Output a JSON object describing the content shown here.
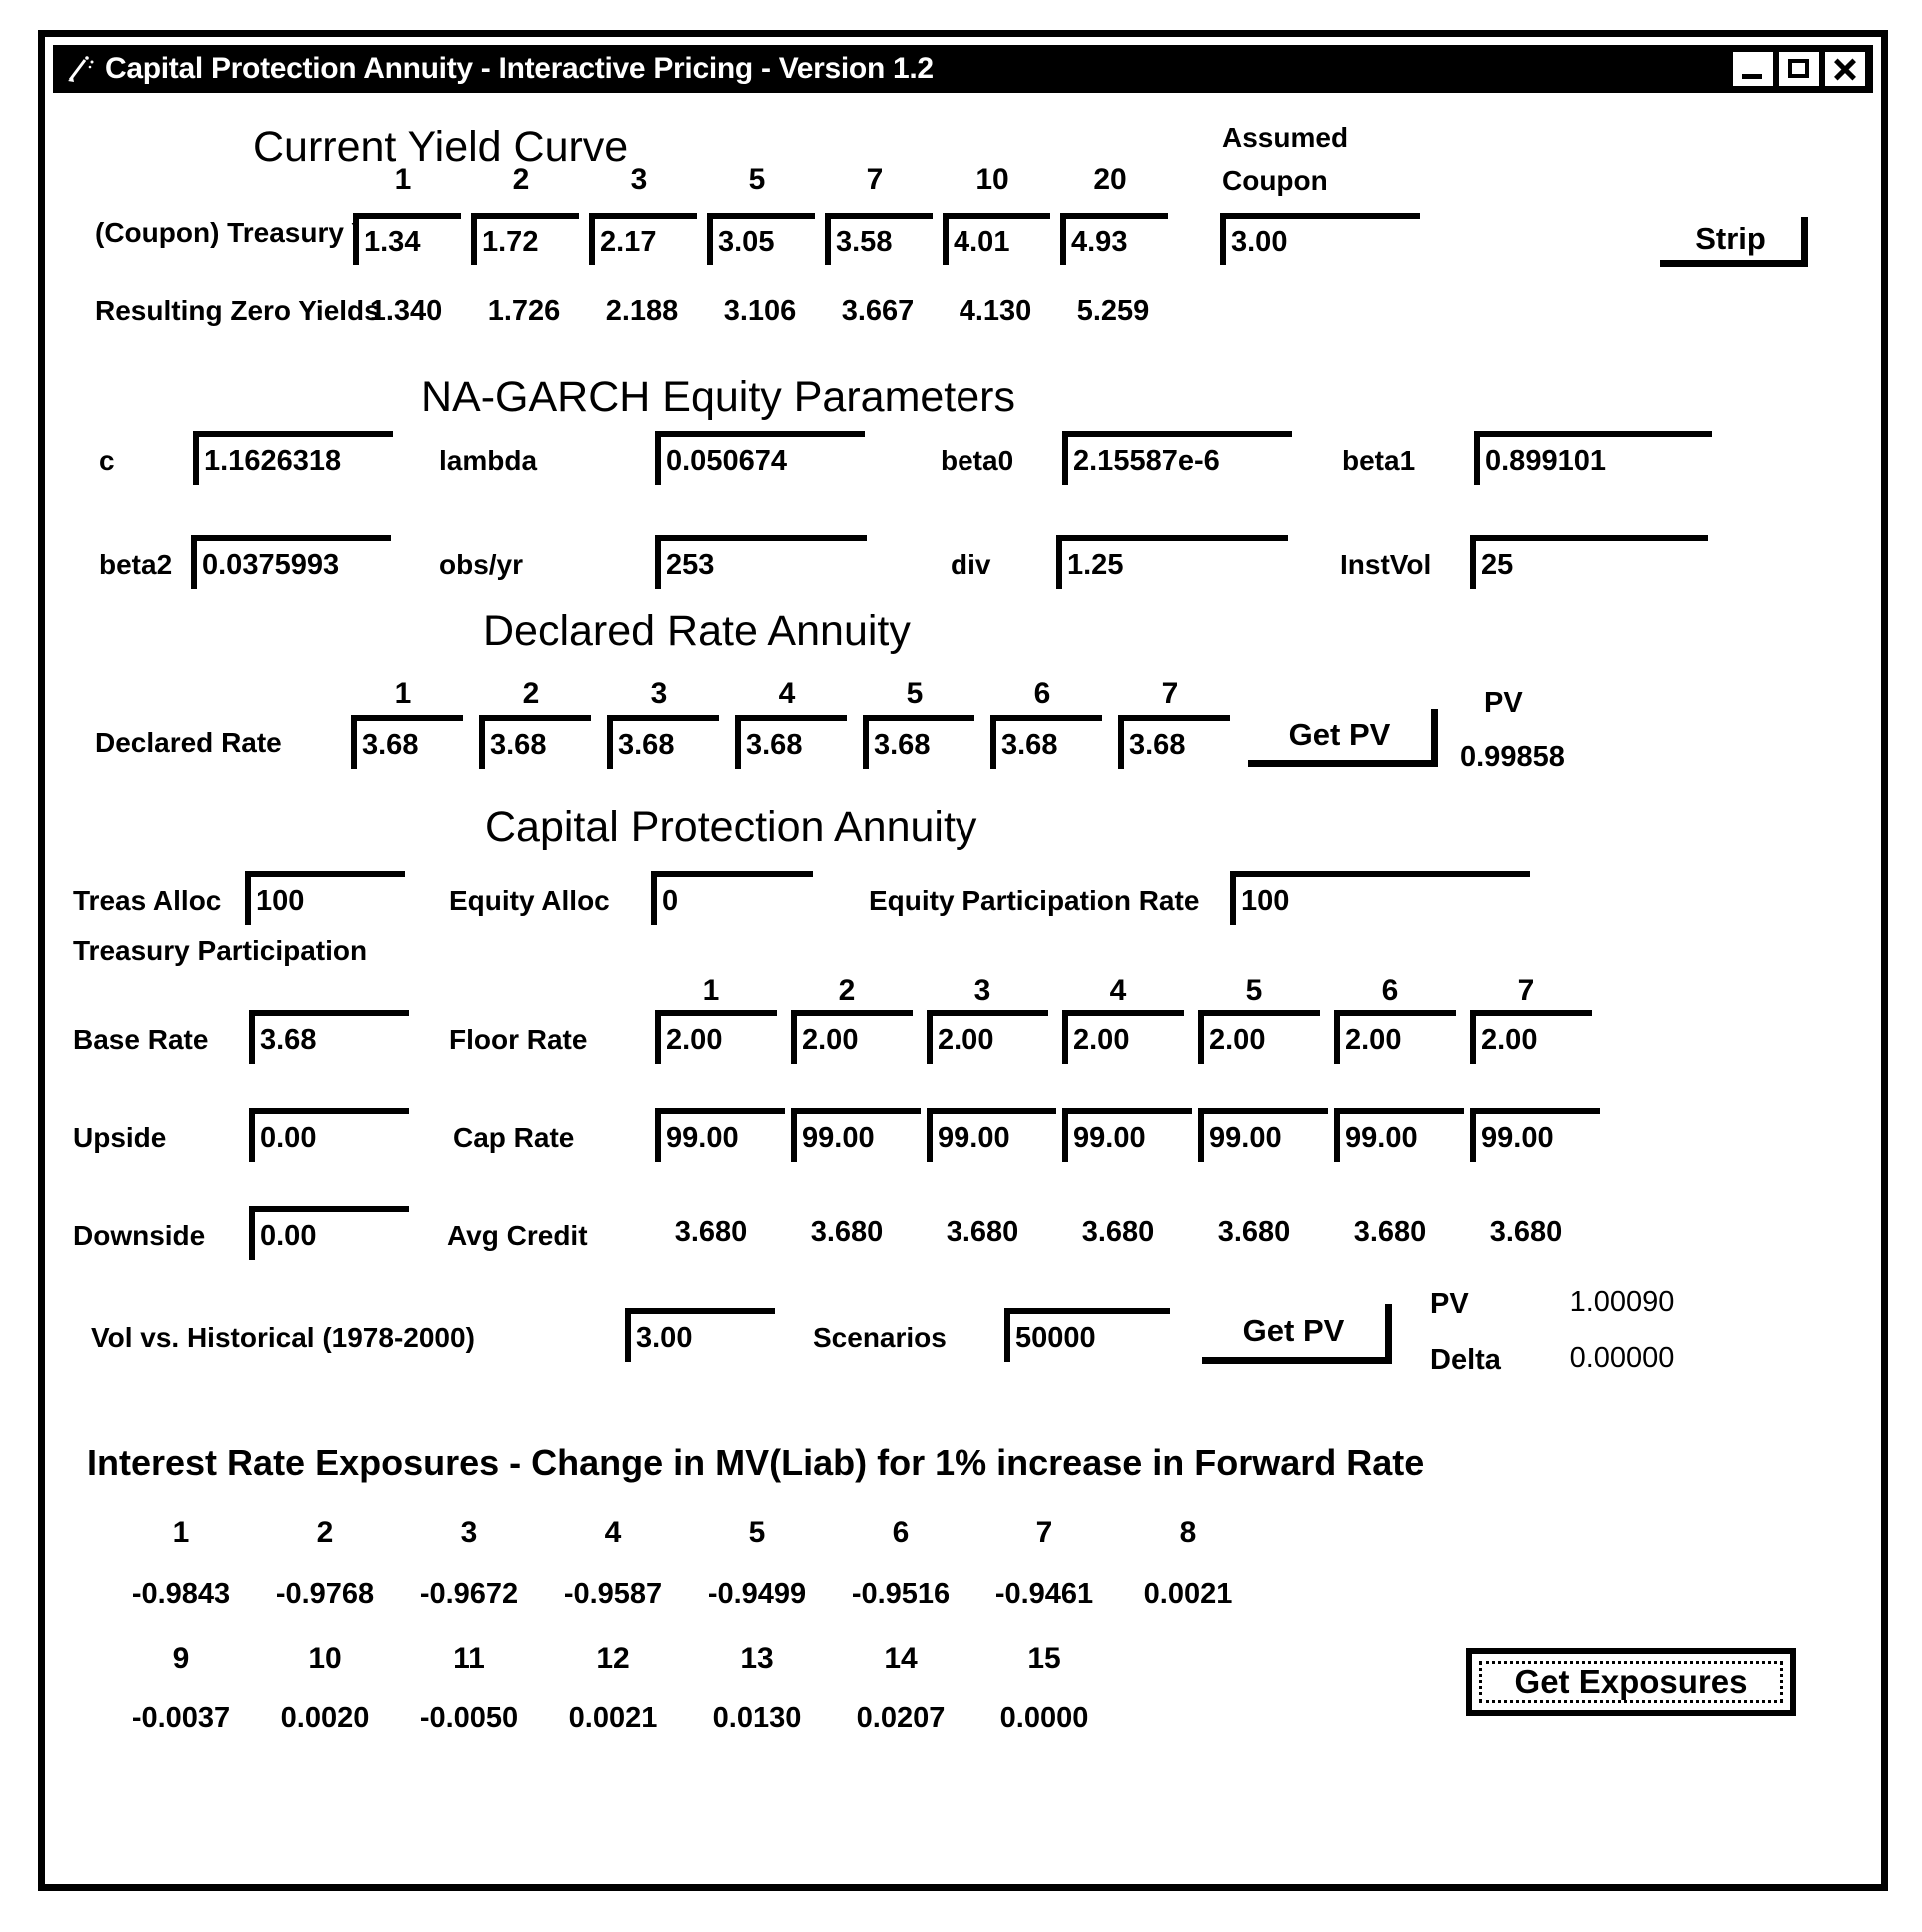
{
  "window": {
    "title": "Capital Protection Annuity - Interactive Pricing - Version 1.2",
    "icon": "wand-icon",
    "minimize_label": "",
    "maximize_label": "",
    "close_label": ""
  },
  "yield_curve": {
    "heading": "Current Yield Curve",
    "row_label": "(Coupon) Treasury Yields",
    "tenors": [
      "1",
      "2",
      "3",
      "5",
      "7",
      "10",
      "20"
    ],
    "yields": [
      "1.34",
      "1.72",
      "2.17",
      "3.05",
      "3.58",
      "4.01",
      "4.93"
    ],
    "assumed_coupon_label_1": "Assumed",
    "assumed_coupon_label_2": "Coupon",
    "assumed_coupon": "3.00",
    "strip_label": "Strip",
    "zero_label": "Resulting Zero Yields",
    "zero_yields": [
      "1.340",
      "1.726",
      "2.188",
      "3.106",
      "3.667",
      "4.130",
      "5.259"
    ]
  },
  "garch": {
    "heading": "NA-GARCH Equity Parameters",
    "fields": [
      {
        "label": "c",
        "value": "1.1626318"
      },
      {
        "label": "lambda",
        "value": "0.050674"
      },
      {
        "label": "beta0",
        "value": "2.15587e-6"
      },
      {
        "label": "beta1",
        "value": "0.899101"
      },
      {
        "label": "beta2",
        "value": "0.0375993"
      },
      {
        "label": "obs/yr",
        "value": "253"
      },
      {
        "label": "div",
        "value": "1.25"
      },
      {
        "label": "InstVol",
        "value": "25"
      }
    ]
  },
  "declared": {
    "heading": "Declared Rate Annuity",
    "row_label": "Declared Rate",
    "years": [
      "1",
      "2",
      "3",
      "4",
      "5",
      "6",
      "7"
    ],
    "rates": [
      "3.68",
      "3.68",
      "3.68",
      "3.68",
      "3.68",
      "3.68",
      "3.68"
    ],
    "get_pv_label": "Get PV",
    "pv_label": "PV",
    "pv_value": "0.99858"
  },
  "cpa": {
    "heading": "Capital Protection Annuity",
    "treas_alloc_label": "Treas Alloc",
    "treas_alloc": "100",
    "equity_alloc_label": "Equity Alloc",
    "equity_alloc": "0",
    "equity_participation_label": "Equity Participation Rate",
    "equity_participation": "100",
    "treasury_participation_label": "Treasury Participation",
    "years": [
      "1",
      "2",
      "3",
      "4",
      "5",
      "6",
      "7"
    ],
    "base_rate_label": "Base Rate",
    "base_rate": "3.68",
    "upside_label": "Upside",
    "upside": "0.00",
    "downside_label": "Downside",
    "downside": "0.00",
    "floor_rate_label": "Floor Rate",
    "floor_rates": [
      "2.00",
      "2.00",
      "2.00",
      "2.00",
      "2.00",
      "2.00",
      "2.00"
    ],
    "cap_rate_label": "Cap Rate",
    "cap_rates": [
      "99.00",
      "99.00",
      "99.00",
      "99.00",
      "99.00",
      "99.00",
      "99.00"
    ],
    "avg_credit_label": "Avg Credit",
    "avg_credits": [
      "3.680",
      "3.680",
      "3.680",
      "3.680",
      "3.680",
      "3.680",
      "3.680"
    ],
    "vol_label": "Vol vs. Historical (1978-2000)",
    "vol_value": "3.00",
    "scenarios_label": "Scenarios",
    "scenarios_value": "50000",
    "get_pv_label": "Get PV",
    "pv_label": "PV",
    "pv_value": "1.00090",
    "delta_label": "Delta",
    "delta_value": "0.00000"
  },
  "exposures": {
    "heading": "Interest Rate Exposures - Change in MV(Liab) for 1% increase in Forward Rate",
    "row1_indices": [
      "1",
      "2",
      "3",
      "4",
      "5",
      "6",
      "7",
      "8"
    ],
    "row1_values": [
      "-0.9843",
      "-0.9768",
      "-0.9672",
      "-0.9587",
      "-0.9499",
      "-0.9516",
      "-0.9461",
      "0.0021"
    ],
    "row2_indices": [
      "9",
      "10",
      "11",
      "12",
      "13",
      "14",
      "15"
    ],
    "row2_values": [
      "-0.0037",
      "0.0020",
      "-0.0050",
      "0.0021",
      "0.0130",
      "0.0207",
      "0.0000"
    ],
    "get_exposures_label": "Get Exposures"
  }
}
